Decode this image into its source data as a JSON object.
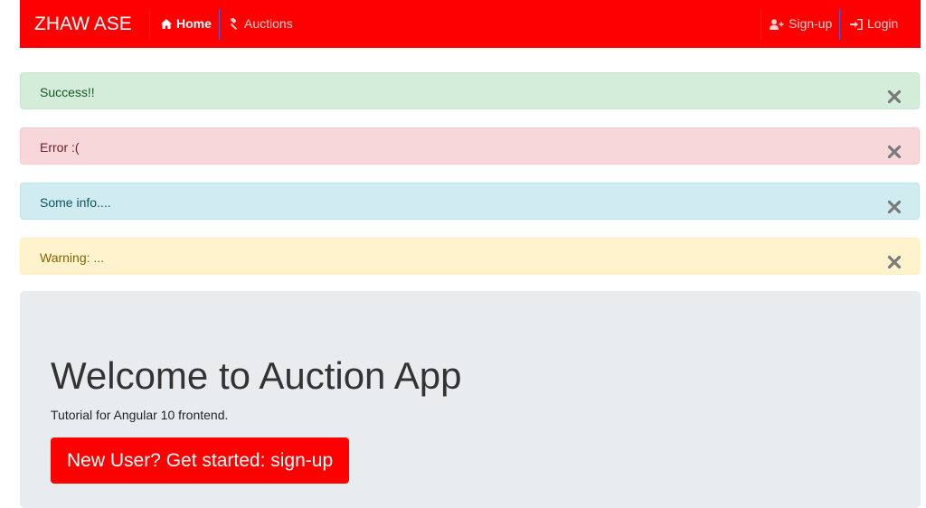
{
  "navbar": {
    "brand": "ZHAW ASE",
    "background": "#ff0000",
    "items": [
      {
        "label": "Home",
        "icon": "home-icon",
        "active": true
      },
      {
        "label": "Auctions",
        "icon": "gavel-icon",
        "active": false
      }
    ],
    "right_items": [
      {
        "label": "Sign-up",
        "icon": "user-plus-icon"
      },
      {
        "label": "Login",
        "icon": "sign-in-icon"
      }
    ]
  },
  "alerts": [
    {
      "type": "success",
      "text": "Success!!",
      "close_icon": "close-icon"
    },
    {
      "type": "danger",
      "text": "Error :(",
      "close_icon": "close-icon"
    },
    {
      "type": "info",
      "text": "Some info....",
      "close_icon": "close-icon"
    },
    {
      "type": "warning",
      "text": "Warning: ...",
      "close_icon": "close-icon"
    }
  ],
  "jumbotron": {
    "title": "Welcome to Auction App",
    "subtitle": "Tutorial for Angular 10 frontend.",
    "button_label": "New User? Get started: sign-up",
    "button_color": "#ff0000"
  }
}
